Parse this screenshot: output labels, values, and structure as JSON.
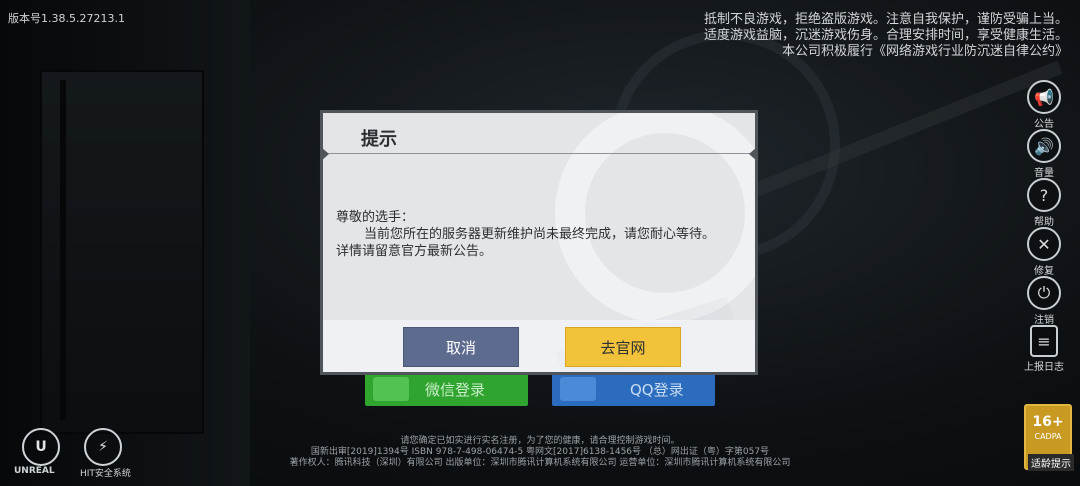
{
  "version_label": "版本号1.38.5.27213.1",
  "health_notice": {
    "line1": "抵制不良游戏，拒绝盗版游戏。注意自我保护，谨防受骗上当。",
    "line2": "适度游戏益脑，沉迷游戏伤身。合理安排时间，享受健康生活。",
    "line3": "本公司积极履行《网络游戏行业防沉迷自律公约》"
  },
  "side_menu": {
    "announcement": "公告",
    "volume": "音量",
    "help": "帮助",
    "repair": "修复",
    "logout": "注销",
    "report_log": "上报日志"
  },
  "age_rating": {
    "value": "16+",
    "org": "CADPA",
    "label": "适龄提示"
  },
  "login": {
    "wechat": "微信登录",
    "qq": "QQ登录"
  },
  "footer": {
    "line1": "请您确定已如实进行实名注册，为了您的健康，请合理控制游戏时间。",
    "line2": "国新出审[2019]1394号   ISBN 978-7-498-06474-5   粤网文[2017]6138-1456号 （总）网出证（粤）字第057号",
    "line3": "著作权人：腾讯科技（深圳）有限公司    出版单位：深圳市腾讯计算机系统有限公司    运营单位：深圳市腾讯计算机系统有限公司"
  },
  "logos": {
    "unreal": "UNREAL",
    "hit": "HIT安全系统"
  },
  "dialog": {
    "title": "提示",
    "greeting": "尊敬的选手：",
    "message": "当前您所在的服务器更新维护尚未最终完成，请您耐心等待。详情请留意官方最新公告。",
    "cancel_label": "取消",
    "official_site_label": "去官网"
  }
}
